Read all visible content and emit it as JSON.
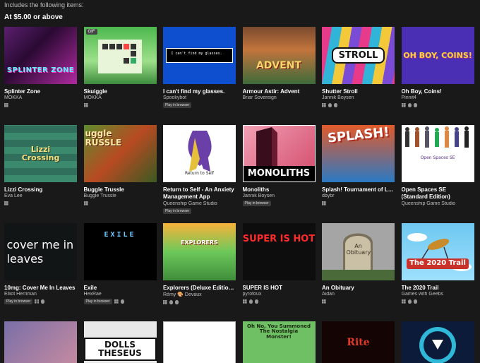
{
  "intro": "Includes the following items:",
  "tier_title": "At $5.00 or above",
  "badges": {
    "gif": "GIF",
    "play_in_browser": "Play in browser"
  },
  "games": [
    {
      "title": "Splinter Zone",
      "author": "MOKKA",
      "art": "SPLINTER ZONE",
      "play": false,
      "platforms": [
        "windows"
      ]
    },
    {
      "title": "Skuiggle",
      "author": "MOKKA",
      "art": "",
      "play": false,
      "platforms": [
        "windows"
      ]
    },
    {
      "title": "I can't find my glasses.",
      "author": "Spookybot",
      "art": "I can't find my glasses.",
      "play": true,
      "platforms": []
    },
    {
      "title": "Armour Astir: Advent",
      "author": "Briar Sovereign",
      "art": "ADVENT",
      "play": false,
      "platforms": []
    },
    {
      "title": "Shutter Stroll",
      "author": "Jannik Boysen",
      "art": "STROLL",
      "play": false,
      "platforms": [
        "windows",
        "linux",
        "mac"
      ]
    },
    {
      "title": "Oh Boy, Coins!",
      "author": "Pinnit4",
      "art": "OH BOY, COINS!",
      "play": false,
      "platforms": [
        "windows",
        "linux",
        "mac"
      ]
    },
    {
      "title": "Lizzi Crossing",
      "author": "Eva Lee",
      "art": "Lizzi Crossing",
      "play": false,
      "platforms": [
        "windows"
      ]
    },
    {
      "title": "Buggle Trussle",
      "author": "Buggle Trussle",
      "art": "uggle RUSSLE",
      "play": false,
      "platforms": [
        "windows"
      ]
    },
    {
      "title": "Return to Self - An Anxiety Management App",
      "author": "Queenship Game Studio",
      "art": "Return to Self",
      "play": true,
      "platforms": []
    },
    {
      "title": "Monoliths",
      "author": "Jannik Boysen",
      "art": "MONOLITHS",
      "play": true,
      "platforms": []
    },
    {
      "title": "Splash! Tournament of Love",
      "author": "dbybr",
      "art": "SPLASH!",
      "play": false,
      "platforms": [
        "windows"
      ]
    },
    {
      "title": "Open Spaces SE (Standard Edition)",
      "author": "Queenship Game Studio",
      "art": "Open Spaces SE",
      "play": false,
      "platforms": []
    },
    {
      "title": "10mg: Cover Me In Leaves",
      "author": "Elliot Herriman",
      "art": "cover me in leaves",
      "play": true,
      "platforms": [
        "windows",
        "mac"
      ]
    },
    {
      "title": "Exile",
      "author": "HexRae",
      "art": "EXILE",
      "play": true,
      "platforms": [
        "windows",
        "mac"
      ]
    },
    {
      "title": "Explorers (Deluxe Edition 🎒)",
      "author": "Rémy 🎨 Devaux",
      "art": "EXPLORERS",
      "play": false,
      "platforms": [
        "windows",
        "linux",
        "mac"
      ]
    },
    {
      "title": "SUPER IS HOT",
      "author": "pyrofoux",
      "art": "SUPER IS HOT",
      "play": false,
      "platforms": [
        "windows",
        "linux",
        "mac"
      ]
    },
    {
      "title": "An Obituary",
      "author": "Aidan",
      "art": "An Obituary",
      "play": false,
      "platforms": [
        "windows"
      ]
    },
    {
      "title": "The 2020 Trail",
      "author": "Games with Geebs",
      "art": "The 2020 Trail",
      "play": false,
      "platforms": [
        "windows",
        "linux",
        "mac"
      ]
    }
  ],
  "row4_art": [
    "",
    "DOLLS THESEUS",
    "",
    "Oh No, You Summoned The Nostalgia Monster!",
    "Rite",
    ""
  ]
}
